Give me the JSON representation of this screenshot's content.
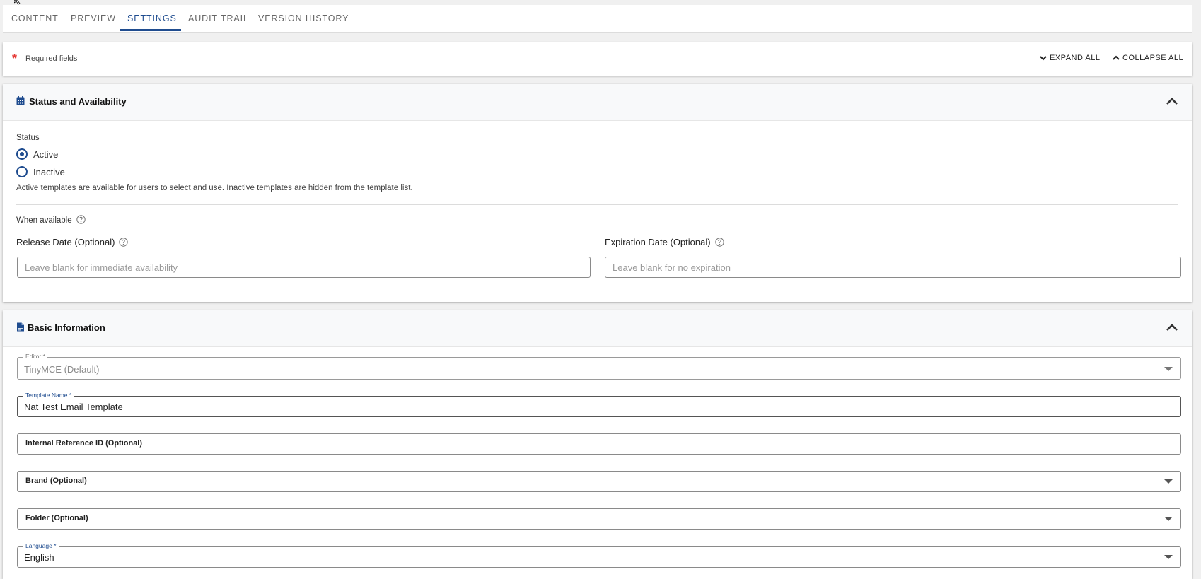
{
  "tabs": [
    {
      "label": "CONTENT"
    },
    {
      "label": "PREVIEW"
    },
    {
      "label": "SETTINGS"
    },
    {
      "label": "AUDIT TRAIL"
    },
    {
      "label": "VERSION HISTORY"
    }
  ],
  "active_tab": "SETTINGS",
  "toolbar": {
    "required_star": "*",
    "required_text": "Required fields",
    "expand_all": "EXPAND ALL",
    "collapse_all": "COLLAPSE ALL"
  },
  "status_section": {
    "title": "Status and Availability",
    "icon": "calendar-icon",
    "status_label": "Status",
    "options": [
      {
        "label": "Active",
        "selected": true
      },
      {
        "label": "Inactive",
        "selected": false
      }
    ],
    "status_help": "Active templates are available for users to select and use. Inactive templates are hidden from the template list.",
    "when_available_label": "When available",
    "release_date": {
      "label": "Release Date (Optional)",
      "placeholder": "Leave blank for immediate availability",
      "value": ""
    },
    "expiration_date": {
      "label": "Expiration Date (Optional)",
      "placeholder": "Leave blank for no expiration",
      "value": ""
    }
  },
  "basic_section": {
    "title": "Basic Information",
    "icon": "document-icon",
    "editor": {
      "label": "Editor *",
      "value": "TinyMCE (Default)"
    },
    "template_name": {
      "label": "Template Name *",
      "value": "Nat Test Email Template"
    },
    "internal_ref": {
      "label": "Internal Reference ID (Optional)",
      "value": ""
    },
    "brand": {
      "label": "Brand (Optional)",
      "value": ""
    },
    "folder": {
      "label": "Folder (Optional)",
      "value": ""
    },
    "language": {
      "label": "Language *",
      "value": "English"
    }
  },
  "colors": {
    "accent": "#1f4c8f",
    "required": "#e53935",
    "page_bg": "#f0f0f0"
  }
}
